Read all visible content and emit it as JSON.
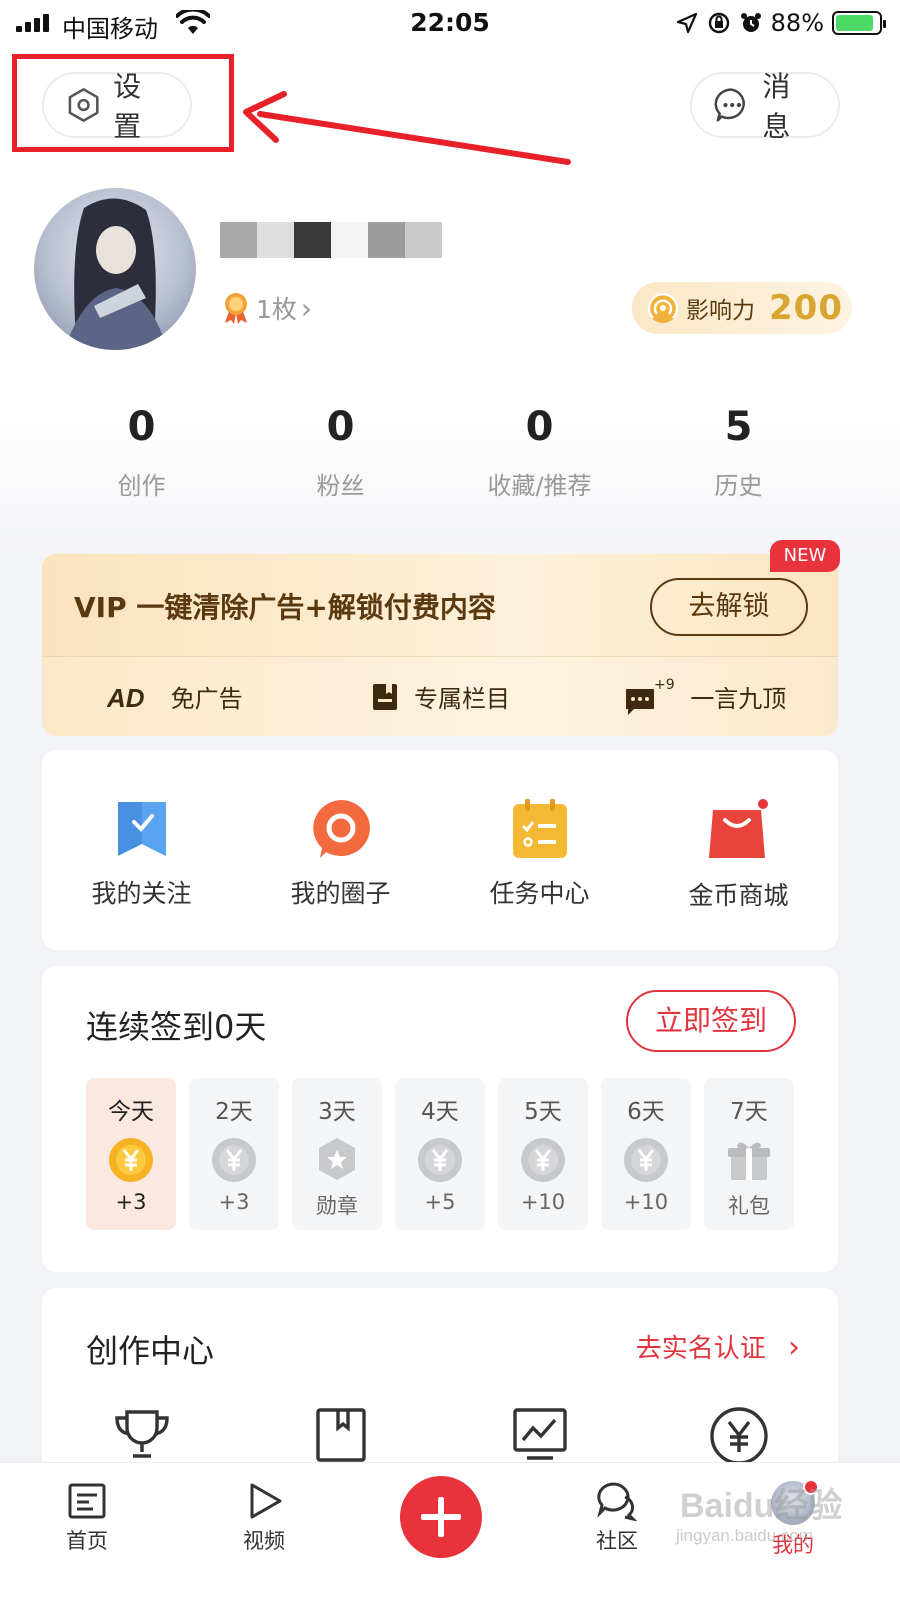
{
  "status_bar": {
    "carrier": "中国移动",
    "time": "22:05",
    "battery_pct": "88%",
    "battery_level": 0.88
  },
  "header": {
    "settings_label": "设置",
    "messages_label": "消息"
  },
  "profile": {
    "medal_count": "1枚",
    "medal_chevron": "›",
    "influence_label": "影响力",
    "influence_value": "200"
  },
  "stats": [
    {
      "value": "0",
      "label": "创作"
    },
    {
      "value": "0",
      "label": "粉丝"
    },
    {
      "value": "0",
      "label": "收藏/推荐"
    },
    {
      "value": "5",
      "label": "历史"
    }
  ],
  "vip": {
    "badge": "NEW",
    "title": "VIP 一键清除广告+解锁付费内容",
    "button": "去解锁",
    "features": [
      {
        "icon": "ad-icon",
        "label": "免广告"
      },
      {
        "icon": "column-book-icon",
        "label": "专属栏目"
      },
      {
        "icon": "comment-boost-icon",
        "badge": "+9",
        "label": "一言九顶"
      }
    ]
  },
  "quick_links": [
    {
      "icon": "bookmark-icon",
      "label": "我的关注",
      "color": "#4a90e2"
    },
    {
      "icon": "chat-circle-icon",
      "label": "我的圈子",
      "color": "#f26a3d"
    },
    {
      "icon": "task-calendar-icon",
      "label": "任务中心",
      "color": "#f5b833"
    },
    {
      "icon": "shopping-bag-icon",
      "label": "金币商城",
      "color": "#e8443c"
    }
  ],
  "checkin": {
    "title": "连续签到0天",
    "button": "立即签到",
    "days": [
      {
        "day": "今天",
        "reward": "+3",
        "icon": "gold-coin-icon"
      },
      {
        "day": "2天",
        "reward": "+3",
        "icon": "coin-icon"
      },
      {
        "day": "3天",
        "reward": "勋章",
        "icon": "medal-icon"
      },
      {
        "day": "4天",
        "reward": "+5",
        "icon": "coin-icon"
      },
      {
        "day": "5天",
        "reward": "+10",
        "icon": "coin-icon"
      },
      {
        "day": "6天",
        "reward": "+10",
        "icon": "coin-icon"
      },
      {
        "day": "7天",
        "reward": "礼包",
        "icon": "gift-icon"
      }
    ]
  },
  "create_center": {
    "title": "创作中心",
    "link": "去实名认证",
    "link_chevron": "›",
    "icons": [
      "trophy-icon",
      "book-icon",
      "chart-icon",
      "yuan-icon"
    ]
  },
  "tab_bar": {
    "tabs": [
      {
        "label": "首页",
        "icon": "home-doc-icon"
      },
      {
        "label": "视频",
        "icon": "play-icon"
      },
      {
        "label": "社区",
        "icon": "community-chat-icon"
      },
      {
        "label": "我的",
        "icon": "avatar"
      }
    ],
    "watermark": "Baidu经验",
    "watermark_sub": "jingyan.baidu.com"
  },
  "colors": {
    "accent_red": "#e0353d",
    "vip_brown": "#5a3810",
    "influence_gold": "#d8a531"
  }
}
